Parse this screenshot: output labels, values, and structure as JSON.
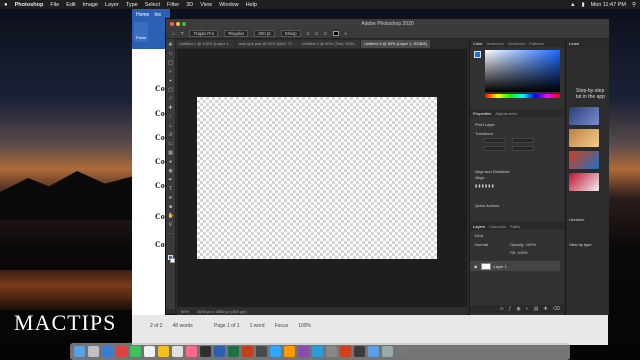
{
  "menubar": {
    "apple": "",
    "app": "Photoshop",
    "items": [
      "File",
      "Edit",
      "Image",
      "Layer",
      "Type",
      "Select",
      "Filter",
      "3D",
      "View",
      "Window",
      "Help"
    ],
    "clock": "Mon 11:47 PM"
  },
  "word": {
    "tabs": [
      "Home",
      "Ins"
    ],
    "paste": "Paste",
    "lines": [
      "Co",
      "Co",
      "Co",
      "Co",
      "Co",
      "Co",
      "Co"
    ],
    "status": {
      "page_of": "2 of 2",
      "words_a": "48 words",
      "page1": "Page 1 of 1",
      "words_b": "1 word",
      "focus": "Focus",
      "zoom": "100%"
    }
  },
  "ps": {
    "title": "Adobe Photoshop 2020",
    "options": {
      "font": "Trajan Pro",
      "style": "Regular",
      "size": "300 pt",
      "aa": "Sharp"
    },
    "tabs": [
      "Untitled-1 @ 100% (Layer 1...",
      "mac tips.psd @ 50% (MAC TI...",
      "Untitled-2 @ 50% (Text, RGB...",
      "Untitled-3 @ 50% (Layer 1, RGB/8)"
    ],
    "status": {
      "zoom": "50%",
      "doc": "3000 px x 1800 px (300 ppi)"
    }
  },
  "panels": {
    "color_tabs": [
      "Color",
      "Swatches",
      "Gradients",
      "Patterns"
    ],
    "properties_tabs": [
      "Properties",
      "Adjustments"
    ],
    "pixel_layer": "Pixel Layer",
    "transform": "Transform",
    "align": "Align and Distribute",
    "align_sub": "Align:",
    "quick_actions": "Quick Actions",
    "layers_tabs": [
      "Layers",
      "Channels",
      "Paths"
    ],
    "kind": "Kind",
    "normal": "Normal",
    "opacity": "Opacity: 100%",
    "fill": "Fill: 100%",
    "layer_name": "Layer 1"
  },
  "learn": {
    "title": "Learn",
    "text": "Step-by-step tut in the app",
    "libraries": "Libraries",
    "view_by": "View by type"
  },
  "logo": {
    "text": "MACTIPS"
  },
  "colors": {
    "accent": "#1d6ed8",
    "ps_dark": "#2b2b2b",
    "word_blue": "#2a5fb3"
  }
}
